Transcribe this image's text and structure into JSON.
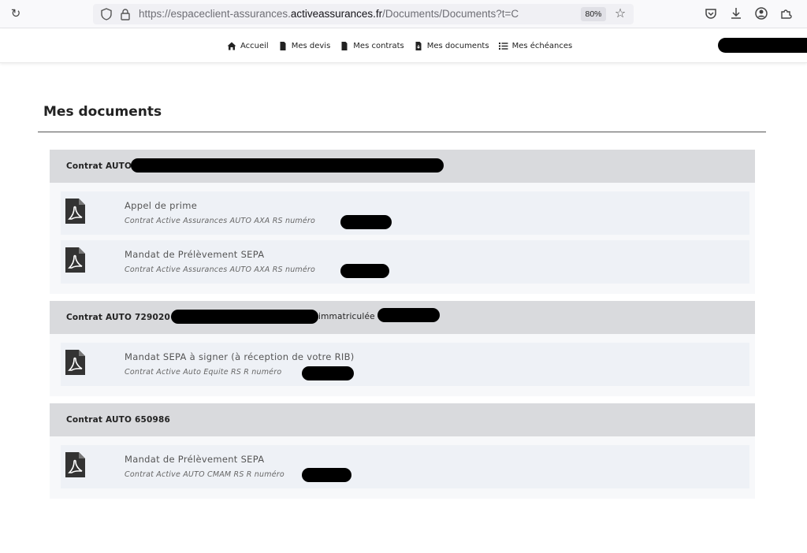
{
  "browser": {
    "url_prefix": "https://espaceclient-assurances.",
    "url_domain": "activeassurances.fr",
    "url_path": "/Documents/Documents?t=C",
    "zoom": "80%",
    "icons": [
      "reload-icon",
      "shield-icon",
      "lock-icon",
      "bookmark-star-icon",
      "pocket-icon",
      "download-icon",
      "account-icon",
      "extensions-icon"
    ]
  },
  "nav": {
    "items": [
      {
        "label": "Accueil",
        "icon": "home-icon"
      },
      {
        "label": "Mes devis",
        "icon": "document-icon"
      },
      {
        "label": "Mes contrats",
        "icon": "document-icon"
      },
      {
        "label": "Mes documents",
        "icon": "document-download-icon"
      },
      {
        "label": "Mes échéances",
        "icon": "list-icon"
      }
    ]
  },
  "page": {
    "title": "Mes documents"
  },
  "sections": [
    {
      "heading": "Contrat AUTO",
      "heading_suffix": "",
      "documents": [
        {
          "name": "Appel de prime",
          "subtitle": "Contrat Active Assurances AUTO AXA RS numéro"
        },
        {
          "name": "Mandat de Prélèvement SEPA",
          "subtitle": "Contrat Active Assurances AUTO AXA RS numéro"
        }
      ]
    },
    {
      "heading": "Contrat AUTO 729020 -",
      "heading_suffix": "immatriculée",
      "documents": [
        {
          "name": "Mandat SEPA à signer (à réception de votre RIB)",
          "subtitle": "Contrat Active Auto Equite RS R numéro"
        }
      ]
    },
    {
      "heading": "Contrat AUTO 650986",
      "heading_suffix": "",
      "documents": [
        {
          "name": "Mandat de Prélèvement SEPA",
          "subtitle": "Contrat Active AUTO CMAM RS R numéro"
        }
      ]
    }
  ],
  "colors": {
    "section_header_bg": "#d9dadd",
    "doc_row_bg": "#eef1f6",
    "pdf_icon": "#333333"
  }
}
